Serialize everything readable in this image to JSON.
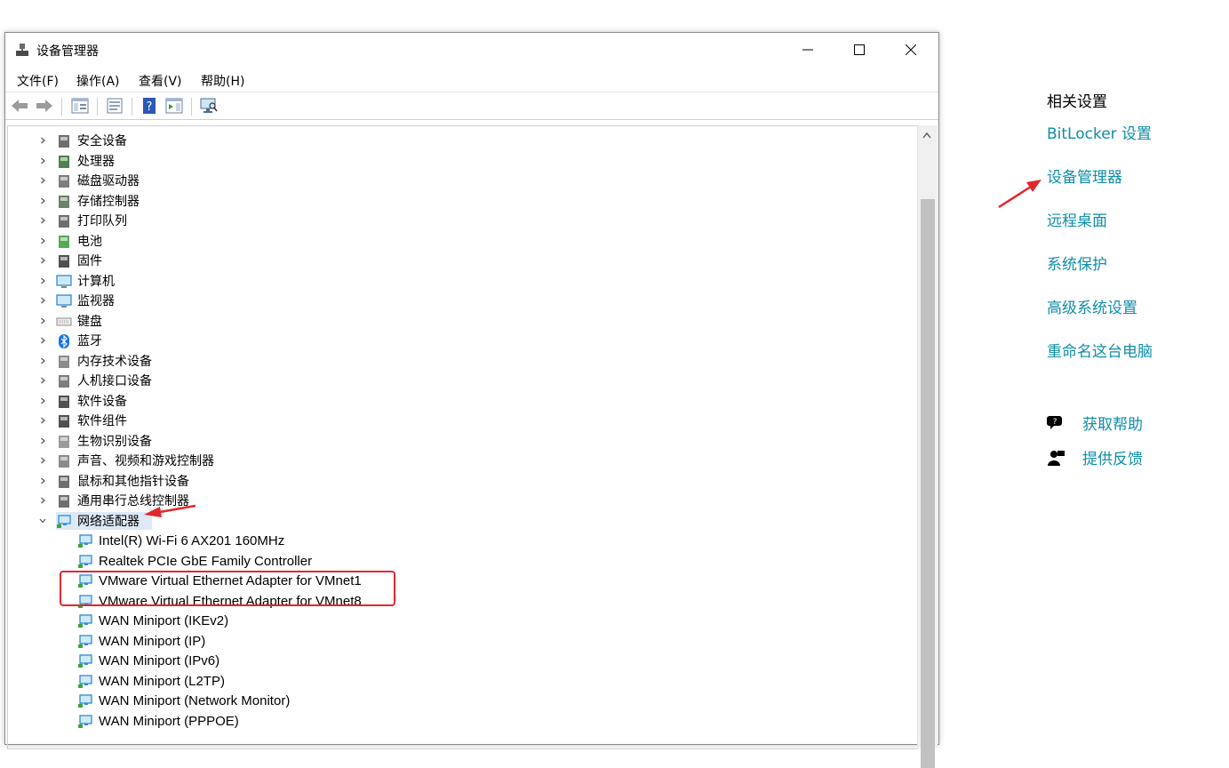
{
  "window": {
    "title": "设备管理器",
    "controls": {
      "minimize": "minimize",
      "maximize": "maximize",
      "close": "close"
    }
  },
  "menu": [
    "文件(F)",
    "操作(A)",
    "查看(V)",
    "帮助(H)"
  ],
  "tree": {
    "categories": [
      {
        "label": "安全设备",
        "icon": "security-device-icon",
        "expanded": false
      },
      {
        "label": "处理器",
        "icon": "processor-icon",
        "expanded": false
      },
      {
        "label": "磁盘驱动器",
        "icon": "disk-drive-icon",
        "expanded": false
      },
      {
        "label": "存储控制器",
        "icon": "storage-controller-icon",
        "expanded": false
      },
      {
        "label": "打印队列",
        "icon": "printer-icon",
        "expanded": false
      },
      {
        "label": "电池",
        "icon": "battery-icon",
        "expanded": false
      },
      {
        "label": "固件",
        "icon": "firmware-icon",
        "expanded": false
      },
      {
        "label": "计算机",
        "icon": "computer-icon",
        "expanded": false
      },
      {
        "label": "监视器",
        "icon": "monitor-icon",
        "expanded": false
      },
      {
        "label": "键盘",
        "icon": "keyboard-icon",
        "expanded": false
      },
      {
        "label": "蓝牙",
        "icon": "bluetooth-icon",
        "expanded": false
      },
      {
        "label": "内存技术设备",
        "icon": "memory-device-icon",
        "expanded": false
      },
      {
        "label": "人机接口设备",
        "icon": "hid-icon",
        "expanded": false
      },
      {
        "label": "软件设备",
        "icon": "software-device-icon",
        "expanded": false
      },
      {
        "label": "软件组件",
        "icon": "software-component-icon",
        "expanded": false
      },
      {
        "label": "生物识别设备",
        "icon": "fingerprint-icon",
        "expanded": false
      },
      {
        "label": "声音、视频和游戏控制器",
        "icon": "speaker-icon",
        "expanded": false
      },
      {
        "label": "鼠标和其他指针设备",
        "icon": "mouse-icon",
        "expanded": false
      },
      {
        "label": "通用串行总线控制器",
        "icon": "usb-icon",
        "expanded": false
      },
      {
        "label": "网络适配器",
        "icon": "network-adapter-icon",
        "expanded": true,
        "selected": true
      }
    ],
    "network_children": [
      "Intel(R) Wi-Fi 6 AX201 160MHz",
      "Realtek PCIe GbE Family Controller",
      "VMware Virtual Ethernet Adapter for VMnet1",
      "VMware Virtual Ethernet Adapter for VMnet8",
      "WAN Miniport (IKEv2)",
      "WAN Miniport (IP)",
      "WAN Miniport (IPv6)",
      "WAN Miniport (L2TP)",
      "WAN Miniport (Network Monitor)",
      "WAN Miniport (PPPOE)"
    ]
  },
  "related": {
    "title": "相关设置",
    "links": [
      "BitLocker 设置",
      "设备管理器",
      "远程桌面",
      "系统保护",
      "高级系统设置",
      "重命名这台电脑"
    ],
    "help": [
      {
        "label": "获取帮助",
        "icon": "help-chat-icon"
      },
      {
        "label": "提供反馈",
        "icon": "feedback-icon"
      }
    ]
  },
  "colors": {
    "link": "#0f8ea8",
    "annotation": "#e3262d",
    "selection": "#dde9f6"
  }
}
